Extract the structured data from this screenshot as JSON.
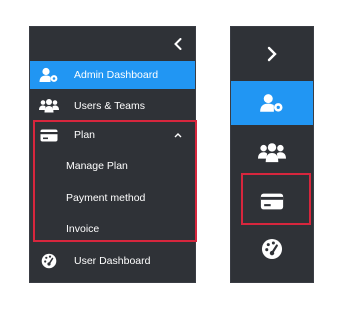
{
  "expanded_sidebar": {
    "items": [
      {
        "label": "Admin Dashboard",
        "icon": "user-gear-icon",
        "active": true
      },
      {
        "label": "Users & Teams",
        "icon": "users-icon",
        "active": false
      },
      {
        "label": "Plan",
        "icon": "credit-card-icon",
        "active": false,
        "expanded": true,
        "children": [
          {
            "label": "Manage Plan"
          },
          {
            "label": "Payment method"
          },
          {
            "label": "Invoice"
          }
        ]
      },
      {
        "label": "User Dashboard",
        "icon": "dashboard-gauge-icon",
        "active": false
      }
    ]
  },
  "collapsed_sidebar": {
    "items": [
      {
        "icon": "user-gear-icon",
        "active": true
      },
      {
        "icon": "users-icon",
        "active": false
      },
      {
        "icon": "credit-card-icon",
        "active": false,
        "highlighted": true
      },
      {
        "icon": "dashboard-gauge-icon",
        "active": false
      }
    ]
  },
  "colors": {
    "sidebar_bg": "#2f3237",
    "active_bg": "#2196f3",
    "highlight": "#d7263d",
    "text": "#ffffff"
  }
}
